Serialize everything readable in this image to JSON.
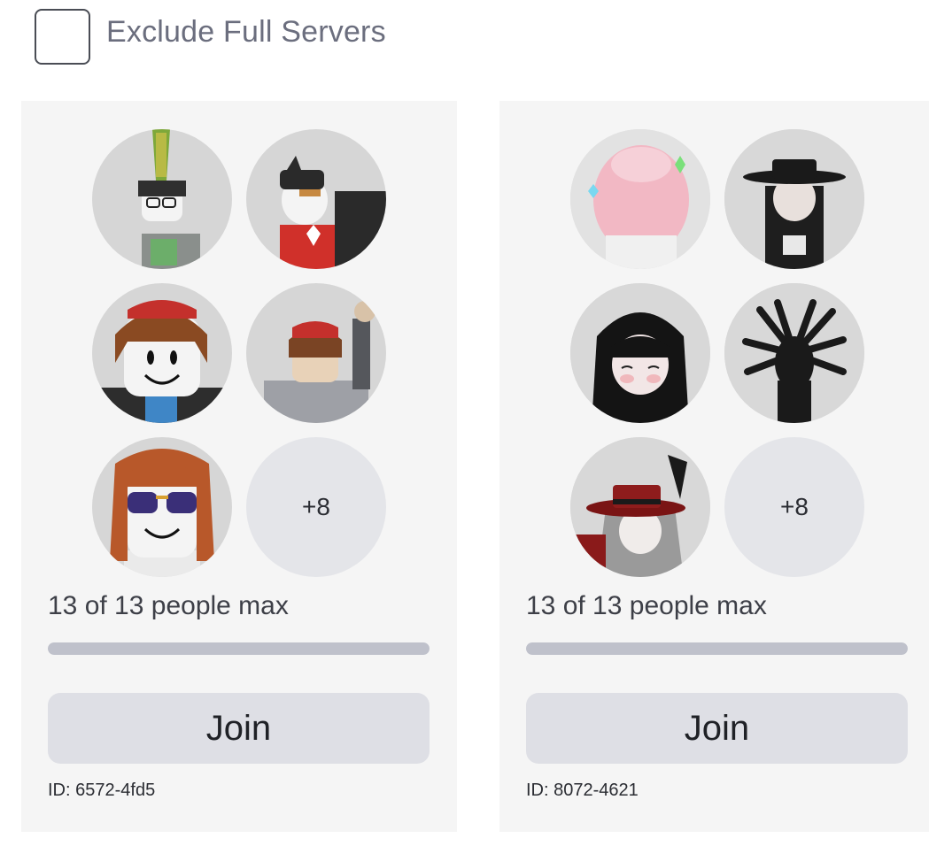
{
  "filter": {
    "label": "Exclude Full Servers",
    "checked": false
  },
  "servers": [
    {
      "extra_players": "+8",
      "capacity_text": "13 of 13 people max",
      "fill_fraction": 1.0,
      "join_label": "Join",
      "id_text": "ID: 6572-4fd5"
    },
    {
      "extra_players": "+8",
      "capacity_text": "13 of 13 people max",
      "fill_fraction": 1.0,
      "join_label": "Join",
      "id_text": "ID: 8072-4621"
    }
  ],
  "colors": {
    "card_bg": "#f5f5f5",
    "avatar_bg": "#d6d6d6",
    "join_bg": "#dedfe5",
    "bar_fill": "#bfc1cb"
  }
}
